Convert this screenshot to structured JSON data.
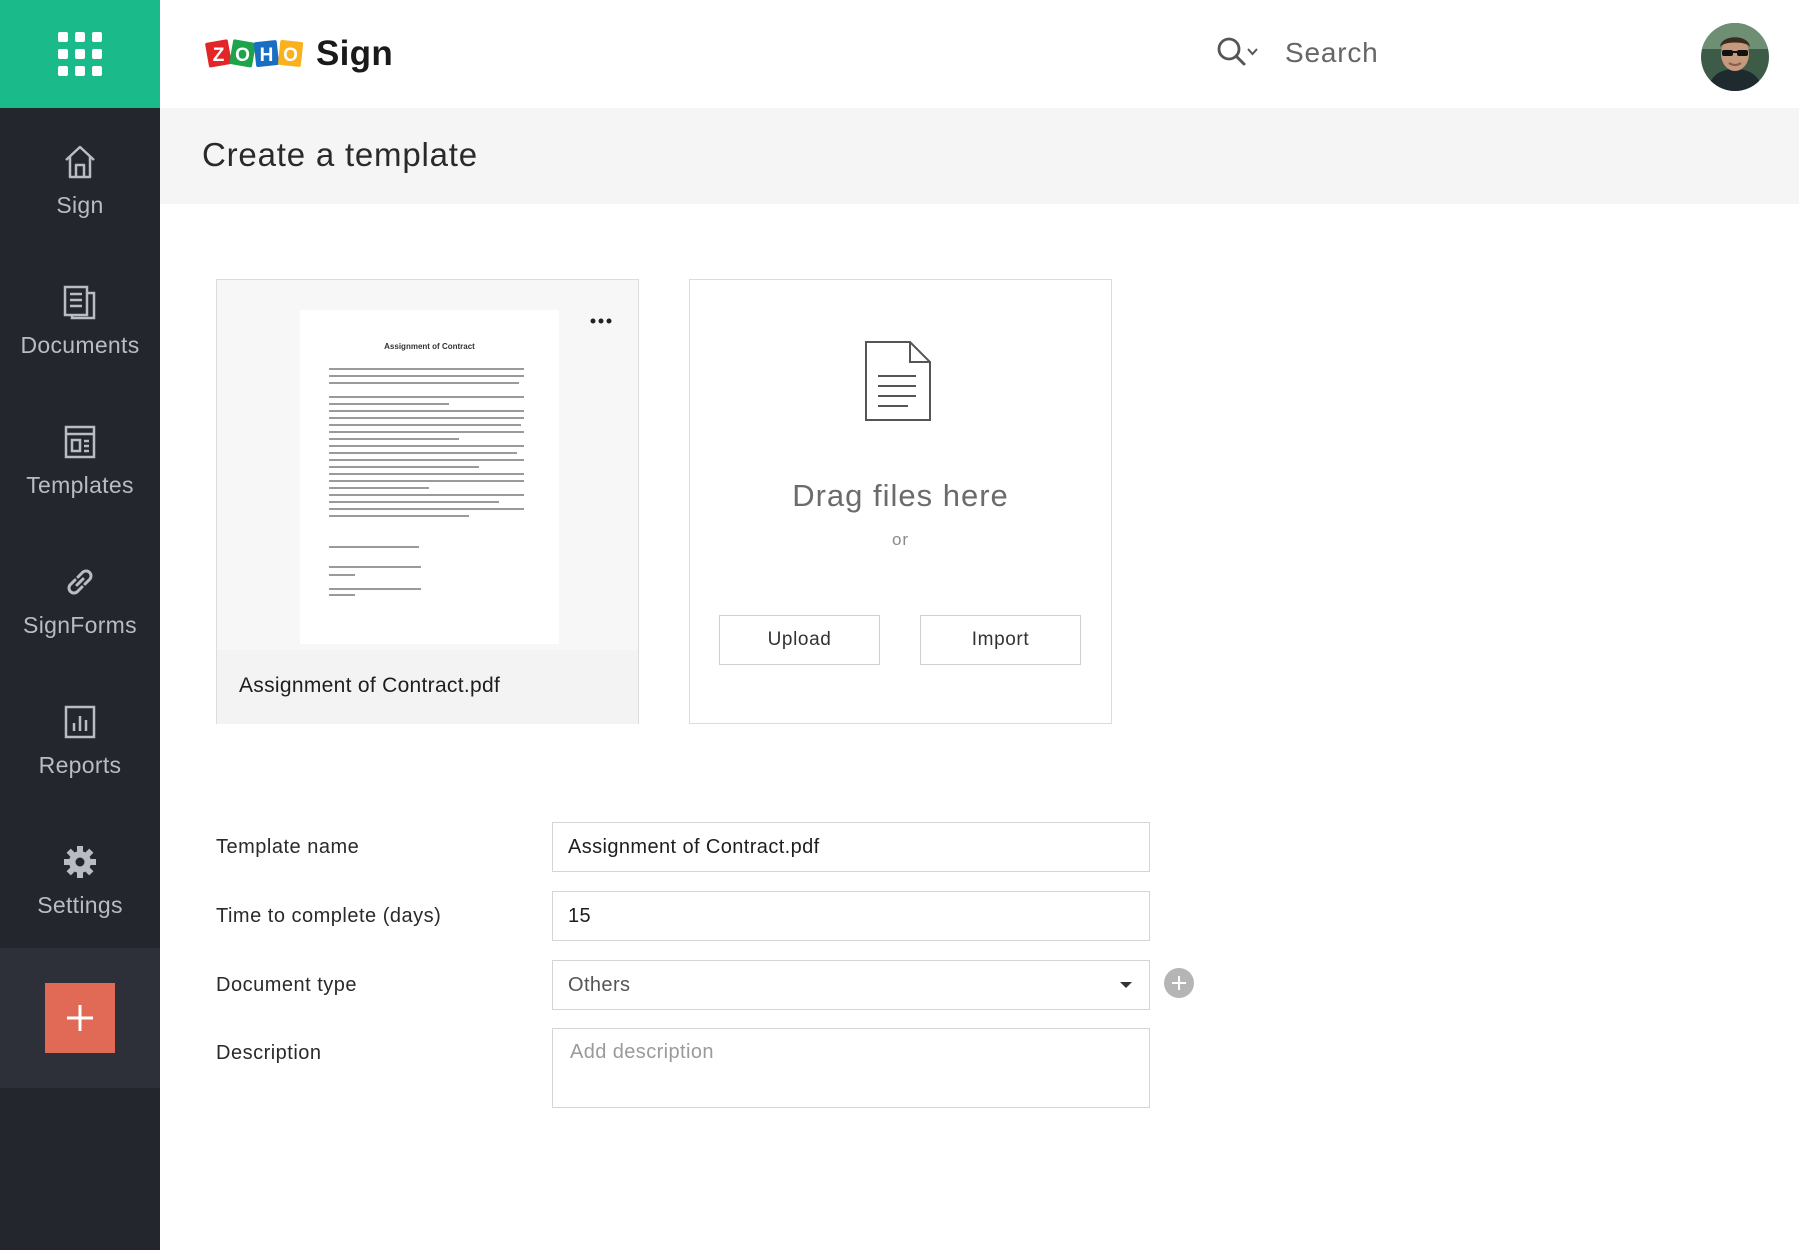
{
  "app": {
    "logo_letters": [
      "Z",
      "O",
      "H",
      "O"
    ],
    "logo_word": "Sign",
    "colors": {
      "brand_green": "#1aba8b",
      "sidebar_bg": "#23262d",
      "add_button": "#e06a55",
      "logo_z": "#e42527",
      "logo_o1": "#1ea24a",
      "logo_h": "#1a6ec2",
      "logo_o2": "#f9b21d"
    }
  },
  "header": {
    "search_placeholder": "Search",
    "search_icon": "search-icon",
    "avatar_icon": "user-avatar"
  },
  "sidebar": {
    "items": [
      {
        "label": "Sign",
        "icon": "home-icon"
      },
      {
        "label": "Documents",
        "icon": "documents-icon"
      },
      {
        "label": "Templates",
        "icon": "templates-icon"
      },
      {
        "label": "SignForms",
        "icon": "link-icon"
      },
      {
        "label": "Reports",
        "icon": "reports-icon"
      },
      {
        "label": "Settings",
        "icon": "gear-icon"
      }
    ],
    "add_icon": "plus-icon"
  },
  "page": {
    "title": "Create a template"
  },
  "document_card": {
    "file_name": "Assignment of Contract.pdf",
    "thumbnail_title": "Assignment of Contract",
    "more_icon": "more-horizontal-icon"
  },
  "upload_card": {
    "drag_text": "Drag files here",
    "or_text": "or",
    "upload_label": "Upload",
    "import_label": "Import",
    "file_icon": "file-icon"
  },
  "form": {
    "template_name": {
      "label": "Template name",
      "value": "Assignment of Contract.pdf"
    },
    "time_to_complete": {
      "label": "Time to complete (days)",
      "value": "15"
    },
    "document_type": {
      "label": "Document type",
      "value": "Others"
    },
    "description": {
      "label": "Description",
      "placeholder": "Add description",
      "value": ""
    }
  }
}
